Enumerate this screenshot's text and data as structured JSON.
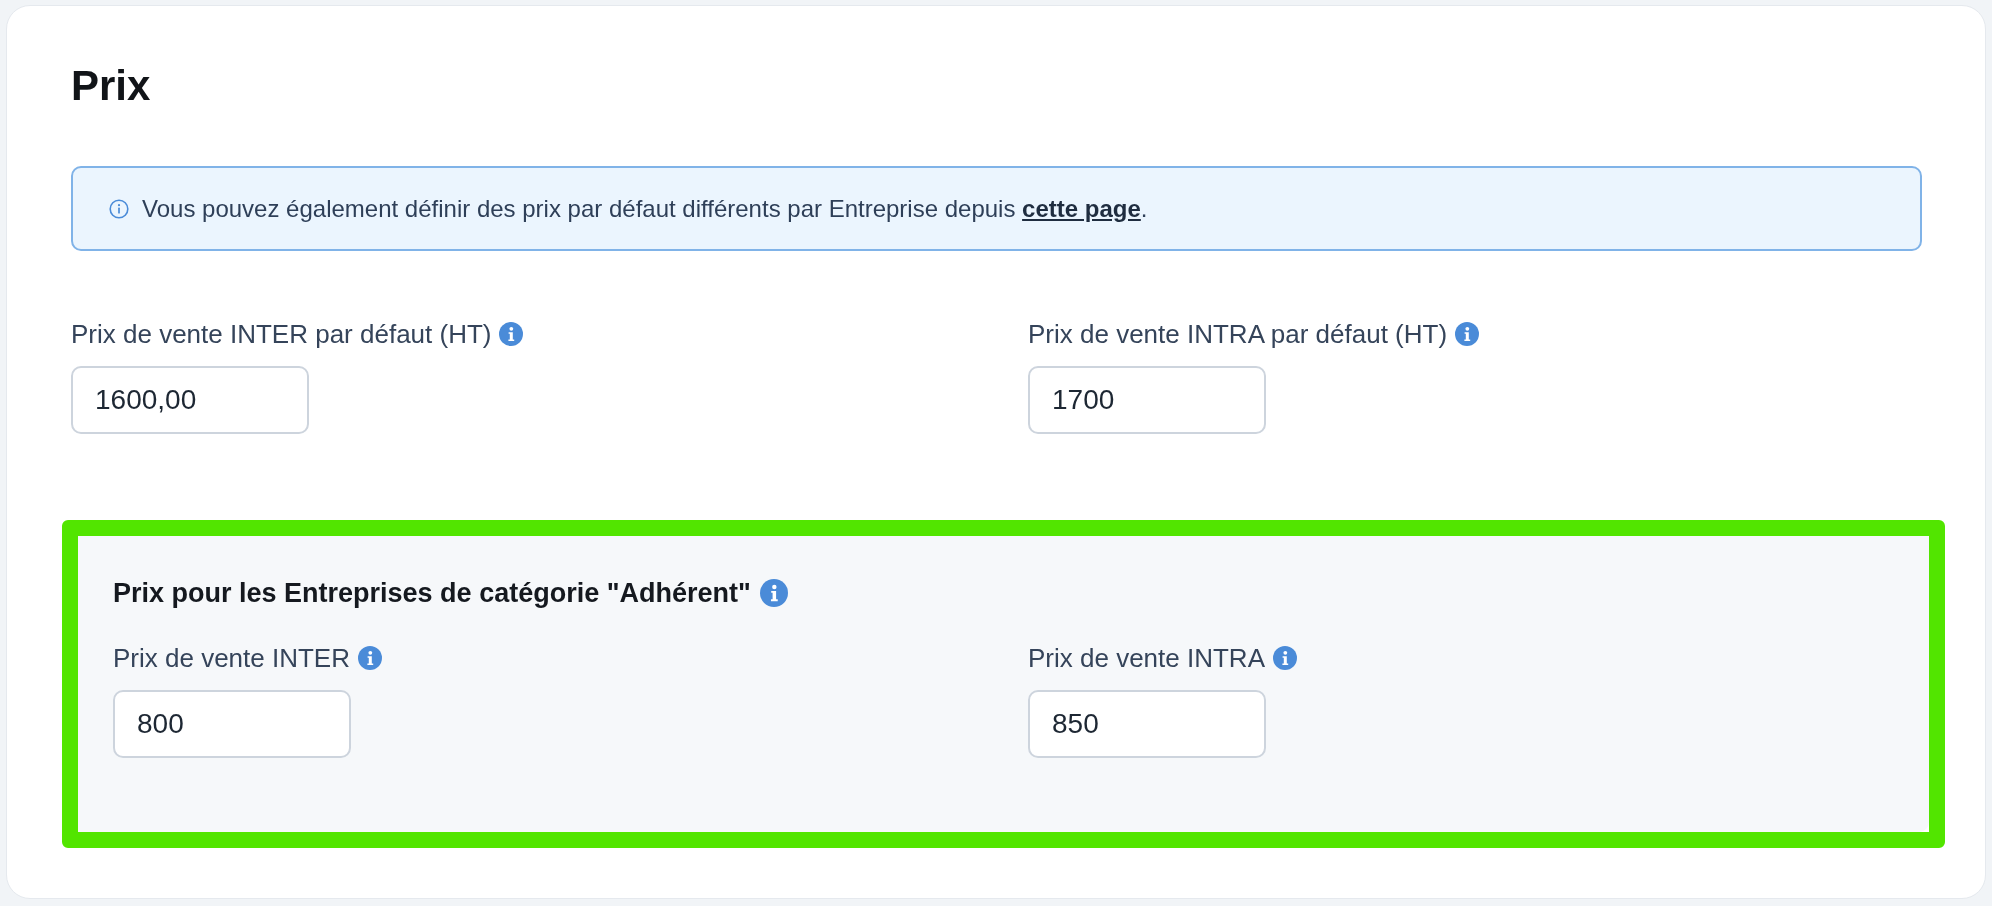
{
  "card": {
    "title": "Prix",
    "notice": {
      "text": "Vous pouvez également définir des prix par défaut différents par Entreprise depuis",
      "link": "cette page",
      "text_after": "."
    },
    "fields": [
      {
        "label": "Prix de vente INTER par défaut (HT)",
        "value": "1600,00"
      },
      {
        "label": "Prix de vente INTRA par défaut (HT)",
        "value": "1700"
      }
    ],
    "category_panel": {
      "title": "Prix pour les Entreprises de catégorie \"Adhérent\"",
      "fields": [
        {
          "label": "Prix de vente INTER",
          "value": "800"
        },
        {
          "label": "Prix de vente INTRA",
          "value": "850"
        }
      ]
    }
  }
}
